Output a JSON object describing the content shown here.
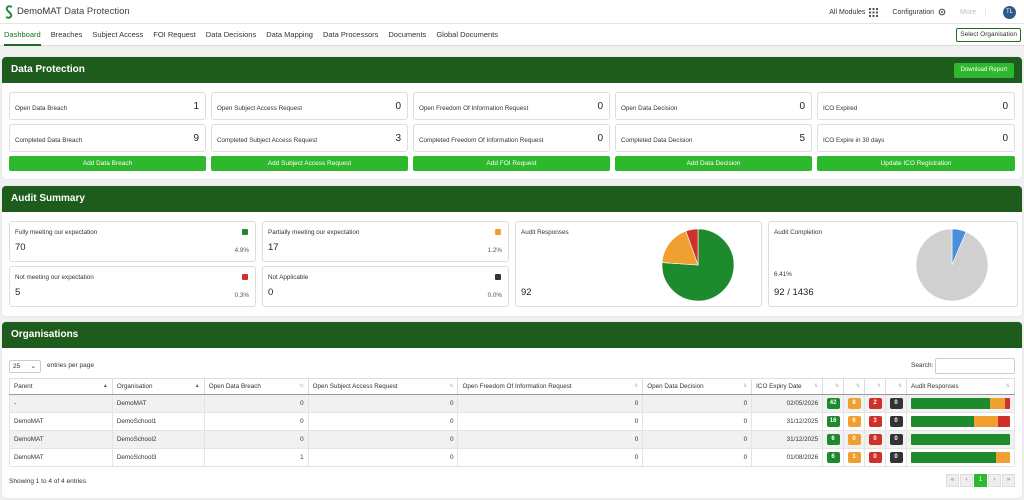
{
  "app": {
    "name": "DemoMAT",
    "module": "Data Protection"
  },
  "topbar": {
    "all_modules": "All Modules",
    "configuration": "Configuration",
    "more": "More",
    "avatar": "TL"
  },
  "nav": {
    "items": [
      "Dashboard",
      "Breaches",
      "Subject Access",
      "FOI Request",
      "Data Decisions",
      "Data Mapping",
      "Data Processors",
      "Documents",
      "Global Documents"
    ],
    "active": "Dashboard",
    "select_org": "Select Organisation"
  },
  "dp": {
    "title": "Data Protection",
    "download": "Download Report",
    "stats": [
      [
        {
          "label": "Open Data Breach",
          "value": "1"
        },
        {
          "label": "Completed Data Breach",
          "value": "9"
        }
      ],
      [
        {
          "label": "Open Subject Access Request",
          "value": "0"
        },
        {
          "label": "Completed Subject Access Request",
          "value": "3"
        }
      ],
      [
        {
          "label": "Open Freedom Of Information Request",
          "value": "0"
        },
        {
          "label": "Completed Freedom Of Information Request",
          "value": "0"
        }
      ],
      [
        {
          "label": "Open Data Decision",
          "value": "0"
        },
        {
          "label": "Completed Data Decision",
          "value": "5"
        }
      ],
      [
        {
          "label": "ICO Expired",
          "value": "0"
        },
        {
          "label": "ICO Expire in 30 days",
          "value": "0"
        }
      ]
    ],
    "buttons": [
      "Add Data Breach",
      "Add Subject Access Request",
      "Add FOI Request",
      "Add Data Decision",
      "Update ICO Registration"
    ]
  },
  "audit": {
    "title": "Audit Summary",
    "cards": [
      {
        "label": "Fully meeting our expectation",
        "value": "70",
        "pct": "4.9%",
        "color": "#1e8a2e"
      },
      {
        "label": "Partially meeting our expectation",
        "value": "17",
        "pct": "1.2%",
        "color": "#f0a030"
      },
      {
        "label": "Not meeting our expectation",
        "value": "5",
        "pct": "0.3%",
        "color": "#d0302a"
      },
      {
        "label": "Not Applicable",
        "value": "0",
        "pct": "0.0%",
        "color": "#333333"
      }
    ],
    "responses": {
      "label": "Audit Responses",
      "value": "92",
      "slices": [
        {
          "value": 70,
          "color": "#1e8a2e"
        },
        {
          "value": 17,
          "color": "#f0a030"
        },
        {
          "value": 5,
          "color": "#d0302a"
        }
      ]
    },
    "completion": {
      "label": "Audit Completion",
      "pct": "6.41%",
      "value": "92 / 1436",
      "slices": [
        {
          "value": 92,
          "color": "#4a8fdc"
        },
        {
          "value": 1344,
          "color": "#d0d0d0"
        }
      ]
    }
  },
  "orgs": {
    "title": "Organisations",
    "entries_value": "25",
    "entries_label": "entries per page",
    "search_label": "Search:",
    "columns": [
      "Parent",
      "Organisation",
      "Open Data Breach",
      "Open Subject Access Request",
      "Open Freedom Of Information Request",
      "Open Data Decision",
      "ICO Expiry Date",
      "",
      "",
      "",
      "",
      "Audit Responses"
    ],
    "rows": [
      {
        "parent": "-",
        "org": "DemoMAT",
        "breach": "0",
        "sar": "0",
        "foi": "0",
        "decision": "0",
        "ico": "02/05/2026",
        "green": "42",
        "amber": "8",
        "red": "2",
        "na": "0",
        "bar": [
          0.8,
          0.15,
          0.05
        ]
      },
      {
        "parent": "DemoMAT",
        "org": "DemoSchool1",
        "breach": "0",
        "sar": "0",
        "foi": "0",
        "decision": "0",
        "ico": "31/12/2025",
        "green": "16",
        "amber": "6",
        "red": "3",
        "na": "0",
        "bar": [
          0.64,
          0.24,
          0.12
        ]
      },
      {
        "parent": "DemoMAT",
        "org": "DemoSchool2",
        "breach": "0",
        "sar": "0",
        "foi": "0",
        "decision": "0",
        "ico": "31/12/2025",
        "green": "6",
        "amber": "0",
        "red": "0",
        "na": "0",
        "bar": [
          1,
          0,
          0
        ]
      },
      {
        "parent": "DemoMAT",
        "org": "DemoSchool3",
        "breach": "1",
        "sar": "0",
        "foi": "0",
        "decision": "0",
        "ico": "01/08/2026",
        "green": "6",
        "amber": "1",
        "red": "0",
        "na": "0",
        "bar": [
          0.857,
          0.143,
          0
        ]
      }
    ],
    "showing": "Showing 1 to 4 of 4 entries",
    "pager": [
      "«",
      "‹",
      "1",
      "›",
      "»"
    ],
    "colors": {
      "green": "#1e8a2e",
      "amber": "#f0a030",
      "red": "#d0302a",
      "na": "#333333"
    }
  }
}
